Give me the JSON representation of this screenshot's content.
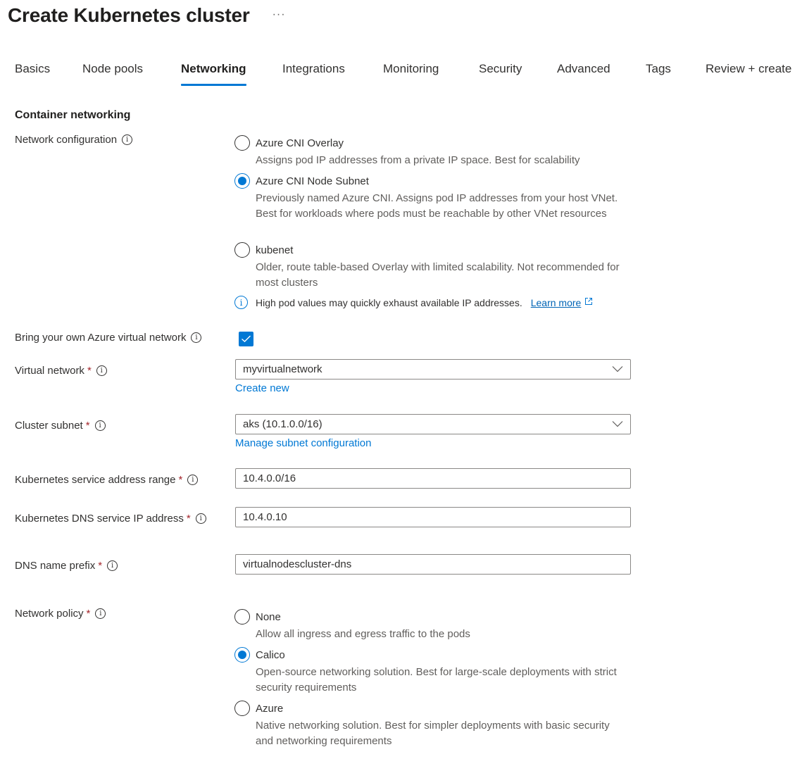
{
  "header": {
    "title": "Create Kubernetes cluster",
    "more_label": "···"
  },
  "tabs": [
    {
      "label": "Basics",
      "active": false
    },
    {
      "label": "Node pools",
      "active": false
    },
    {
      "label": "Networking",
      "active": true
    },
    {
      "label": "Integrations",
      "active": false
    },
    {
      "label": "Monitoring",
      "active": false
    },
    {
      "label": "Security",
      "active": false
    },
    {
      "label": "Advanced",
      "active": false
    },
    {
      "label": "Tags",
      "active": false
    },
    {
      "label": "Review + create",
      "active": false
    }
  ],
  "section": {
    "title": "Container networking"
  },
  "network_configuration": {
    "label": "Network configuration",
    "options": [
      {
        "label": "Azure CNI Overlay",
        "description": "Assigns pod IP addresses from a private IP space. Best for scalability",
        "selected": false
      },
      {
        "label": "Azure CNI Node Subnet",
        "description": "Previously named Azure CNI. Assigns pod IP addresses from your host VNet. Best for workloads where pods must be reachable by other VNet resources",
        "selected": true
      },
      {
        "label": "kubenet",
        "description": "Older, route table-based Overlay with limited scalability. Not recommended for most clusters",
        "selected": false
      }
    ],
    "info_note": "High pod values may quickly exhaust available IP addresses.",
    "learn_more_label": "Learn more"
  },
  "bring_own_vnet": {
    "label": "Bring your own Azure virtual network",
    "checked": true
  },
  "virtual_network": {
    "label": "Virtual network",
    "required_mark": "*",
    "value": "myvirtualnetwork",
    "link_label": "Create new"
  },
  "cluster_subnet": {
    "label": "Cluster subnet",
    "required_mark": "*",
    "value": "aks (10.1.0.0/16)",
    "link_label": "Manage subnet configuration"
  },
  "service_address_range": {
    "label": "Kubernetes service address range",
    "required_mark": "*",
    "value": "10.4.0.0/16"
  },
  "dns_service_ip": {
    "label": "Kubernetes DNS service IP address",
    "required_mark": "*",
    "value": "10.4.0.10"
  },
  "dns_name_prefix": {
    "label": "DNS name prefix",
    "required_mark": "*",
    "value": "virtualnodescluster-dns"
  },
  "network_policy": {
    "label": "Network policy",
    "required_mark": "*",
    "options": [
      {
        "label": "None",
        "description": "Allow all ingress and egress traffic to the pods",
        "selected": false
      },
      {
        "label": "Calico",
        "description": "Open-source networking solution. Best for large-scale deployments with strict security requirements",
        "selected": true
      },
      {
        "label": "Azure",
        "description": "Native networking solution. Best for simpler deployments with basic security and networking requirements",
        "selected": false
      }
    ]
  },
  "colors": {
    "accent": "#0078d4",
    "required": "#a4262c",
    "text": "#323130",
    "secondary_text": "#605e5c"
  }
}
